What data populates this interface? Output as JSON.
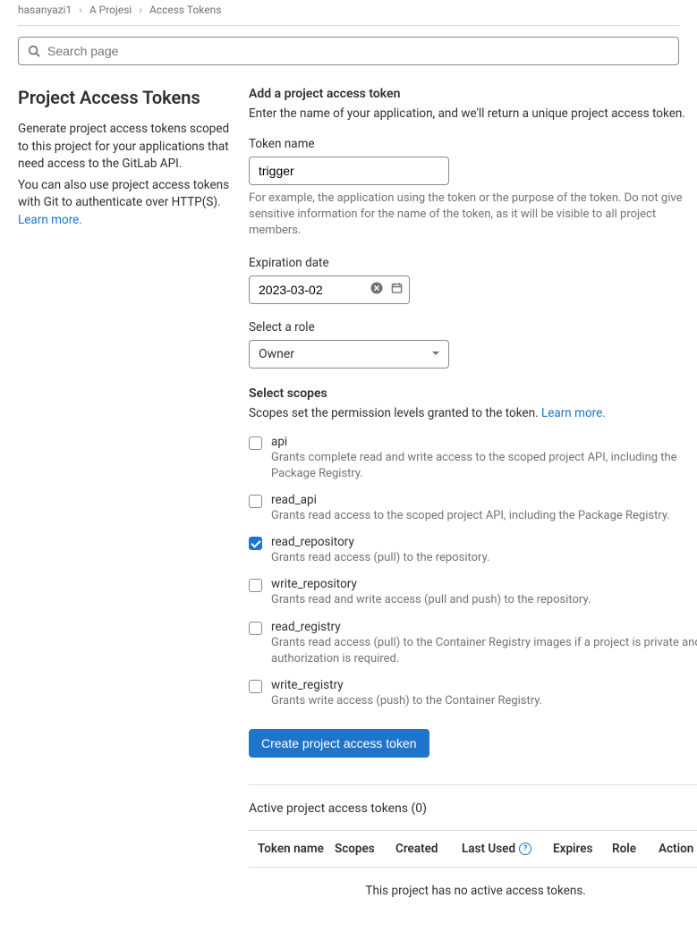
{
  "breadcrumbs": {
    "user": "hasanyazi1",
    "project": "A Projesi",
    "page": "Access Tokens"
  },
  "search": {
    "placeholder": "Search page"
  },
  "sidebar": {
    "title": "Project Access Tokens",
    "p1": "Generate project access tokens scoped to this project for your applications that need access to the GitLab API.",
    "p2_a": "You can also use project access tokens with Git to authenticate over HTTP(S). ",
    "learn_more": "Learn more."
  },
  "form": {
    "heading": "Add a project access token",
    "subheading": "Enter the name of your application, and we'll return a unique project access token.",
    "name_label": "Token name",
    "name_value": "trigger",
    "name_help": "For example, the application using the token or the purpose of the token. Do not give sensitive information for the name of the token, as it will be visible to all project members.",
    "date_label": "Expiration date",
    "date_value": "2023-03-02",
    "role_label": "Select a role",
    "role_value": "Owner",
    "scopes_label": "Select scopes",
    "scopes_help_a": "Scopes set the permission levels granted to the token. ",
    "scopes_learn": "Learn more.",
    "submit_label": "Create project access token"
  },
  "scopes": [
    {
      "name": "api",
      "desc": "Grants complete read and write access to the scoped project API, including the Package Registry.",
      "checked": false
    },
    {
      "name": "read_api",
      "desc": "Grants read access to the scoped project API, including the Package Registry.",
      "checked": false
    },
    {
      "name": "read_repository",
      "desc": "Grants read access (pull) to the repository.",
      "checked": true
    },
    {
      "name": "write_repository",
      "desc": "Grants read and write access (pull and push) to the repository.",
      "checked": false
    },
    {
      "name": "read_registry",
      "desc": "Grants read access (pull) to the Container Registry images if a project is private and authorization is required.",
      "checked": false
    },
    {
      "name": "write_registry",
      "desc": "Grants write access (push) to the Container Registry.",
      "checked": false
    }
  ],
  "tokens_section": {
    "title": "Active project access tokens (0)",
    "th_name": "Token name",
    "th_scopes": "Scopes",
    "th_created": "Created",
    "th_used": "Last Used",
    "th_expires": "Expires",
    "th_role": "Role",
    "th_action": "Action",
    "empty": "This project has no active access tokens."
  }
}
